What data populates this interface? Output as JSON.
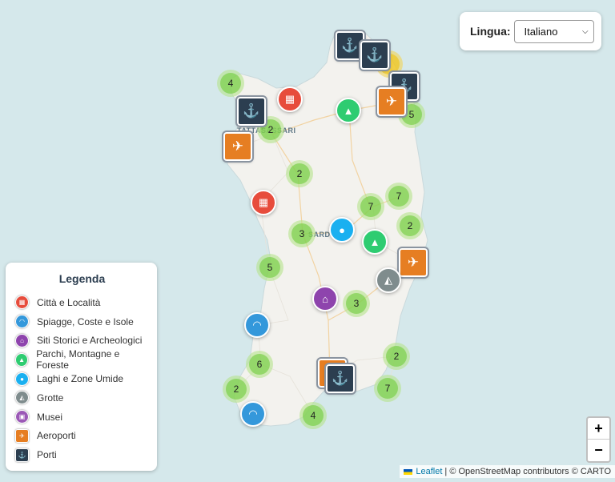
{
  "language_control": {
    "label": "Lingua:",
    "selected": "Italiano"
  },
  "map": {
    "city_labels": [
      "TATTASASSARI",
      "SARD"
    ],
    "clusters": [
      {
        "count": "4",
        "color": "green"
      },
      {
        "count": "2",
        "color": "green"
      },
      {
        "count": "5",
        "color": "green"
      },
      {
        "count": "2",
        "color": "green"
      },
      {
        "count": "7",
        "color": "green"
      },
      {
        "count": "7",
        "color": "green"
      },
      {
        "count": "2",
        "color": "green"
      },
      {
        "count": "3",
        "color": "green"
      },
      {
        "count": "5",
        "color": "green"
      },
      {
        "count": "3",
        "color": "green"
      },
      {
        "count": "2",
        "color": "green"
      },
      {
        "count": "6",
        "color": "green"
      },
      {
        "count": "2",
        "color": "green"
      },
      {
        "count": "7",
        "color": "green"
      },
      {
        "count": "4",
        "color": "green"
      },
      {
        "count": "",
        "color": "yellow"
      }
    ],
    "markers": [
      {
        "category": "porti",
        "icon": "anchor-icon",
        "glyph": "⚓"
      },
      {
        "category": "porti",
        "icon": "anchor-icon",
        "glyph": "⚓"
      },
      {
        "category": "porti",
        "icon": "anchor-icon",
        "glyph": "⚓"
      },
      {
        "category": "aeroporti",
        "icon": "plane-icon",
        "glyph": "✈"
      },
      {
        "category": "porti",
        "icon": "anchor-icon",
        "glyph": "⚓"
      },
      {
        "category": "aeroporti",
        "icon": "plane-icon",
        "glyph": "✈"
      },
      {
        "category": "citta",
        "icon": "city-icon",
        "glyph": "▦"
      },
      {
        "category": "parchi",
        "icon": "tree-icon",
        "glyph": "▲"
      },
      {
        "category": "citta",
        "icon": "city-icon",
        "glyph": "▦"
      },
      {
        "category": "laghi",
        "icon": "droplet-icon",
        "glyph": "●"
      },
      {
        "category": "parchi",
        "icon": "tree-icon",
        "glyph": "▲"
      },
      {
        "category": "aeroporti",
        "icon": "plane-icon",
        "glyph": "✈"
      },
      {
        "category": "grotte",
        "icon": "cave-icon",
        "glyph": "◭"
      },
      {
        "category": "siti",
        "icon": "temple-icon",
        "glyph": "⌂"
      },
      {
        "category": "spiagge",
        "icon": "beach-icon",
        "glyph": "◠"
      },
      {
        "category": "aeroporti",
        "icon": "plane-icon",
        "glyph": "✈"
      },
      {
        "category": "porti",
        "icon": "anchor-icon",
        "glyph": "⚓"
      },
      {
        "category": "spiagge",
        "icon": "beach-icon",
        "glyph": "◠"
      }
    ]
  },
  "legend": {
    "title": "Legenda",
    "items": [
      {
        "label": "Città e Località",
        "color": "#e74c3c",
        "icon": "city-icon",
        "glyph": "▦",
        "shape": "round"
      },
      {
        "label": "Spiagge, Coste e Isole",
        "color": "#3498db",
        "icon": "beach-icon",
        "glyph": "◠",
        "shape": "round"
      },
      {
        "label": "Siti Storici e Archeologici",
        "color": "#8e44ad",
        "icon": "temple-icon",
        "glyph": "⌂",
        "shape": "round"
      },
      {
        "label": "Parchi, Montagne e Foreste",
        "color": "#2ecc71",
        "icon": "tree-icon",
        "glyph": "▲",
        "shape": "round"
      },
      {
        "label": "Laghi e Zone Umide",
        "color": "#1ab0f0",
        "icon": "droplet-icon",
        "glyph": "●",
        "shape": "round"
      },
      {
        "label": "Grotte",
        "color": "#7f8c8d",
        "icon": "cave-icon",
        "glyph": "◭",
        "shape": "round"
      },
      {
        "label": "Musei",
        "color": "#9b59b6",
        "icon": "museum-icon",
        "glyph": "▣",
        "shape": "round"
      },
      {
        "label": "Aeroporti",
        "color": "#e67e22",
        "icon": "plane-icon",
        "glyph": "✈",
        "shape": "square"
      },
      {
        "label": "Porti",
        "color": "#2c3e50",
        "icon": "anchor-icon",
        "glyph": "⚓",
        "shape": "square"
      }
    ]
  },
  "zoom": {
    "in_label": "+",
    "out_label": "−"
  },
  "attribution": {
    "leaflet": "Leaflet",
    "rest": "| © OpenStreetMap contributors © CARTO"
  }
}
